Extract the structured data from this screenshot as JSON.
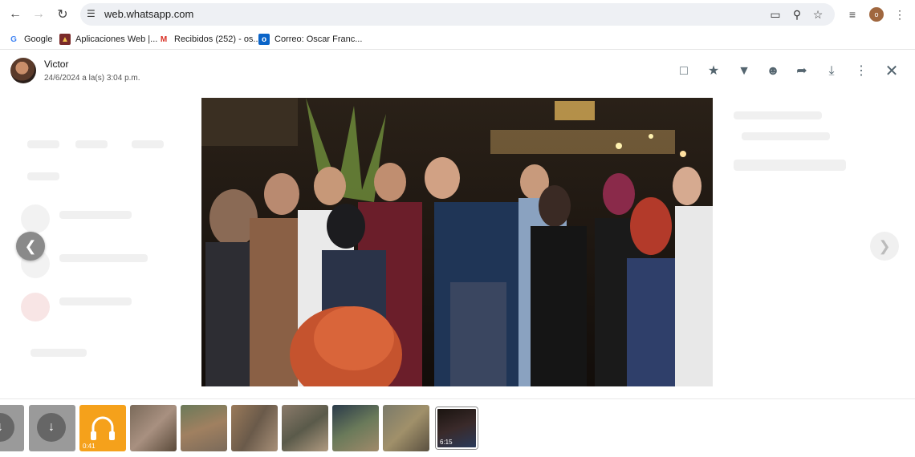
{
  "browser": {
    "url": "web.whatsapp.com",
    "bookmarks": [
      {
        "label": "Google",
        "icon": "google-icon"
      },
      {
        "label": "Aplicaciones Web |...",
        "icon": "app-icon"
      },
      {
        "label": "Recibidos (252) - os...",
        "icon": "gmail-icon"
      },
      {
        "label": "Correo: Oscar Franc...",
        "icon": "outlook-icon"
      }
    ],
    "profile_initial": "o"
  },
  "viewer": {
    "sender": "Victor",
    "timestamp": "24/6/2024 a la(s) 3:04 p.m.",
    "thumbnails": [
      {
        "type": "download"
      },
      {
        "type": "download"
      },
      {
        "type": "audio",
        "duration": "0:41"
      },
      {
        "type": "image"
      },
      {
        "type": "image"
      },
      {
        "type": "image"
      },
      {
        "type": "image"
      },
      {
        "type": "image"
      },
      {
        "type": "image"
      },
      {
        "type": "video",
        "duration": "6:15"
      }
    ]
  },
  "colors": {
    "accent_audio": "#f5a11b",
    "chrome_bg": "#eef0f4",
    "icon": "#54656f"
  }
}
